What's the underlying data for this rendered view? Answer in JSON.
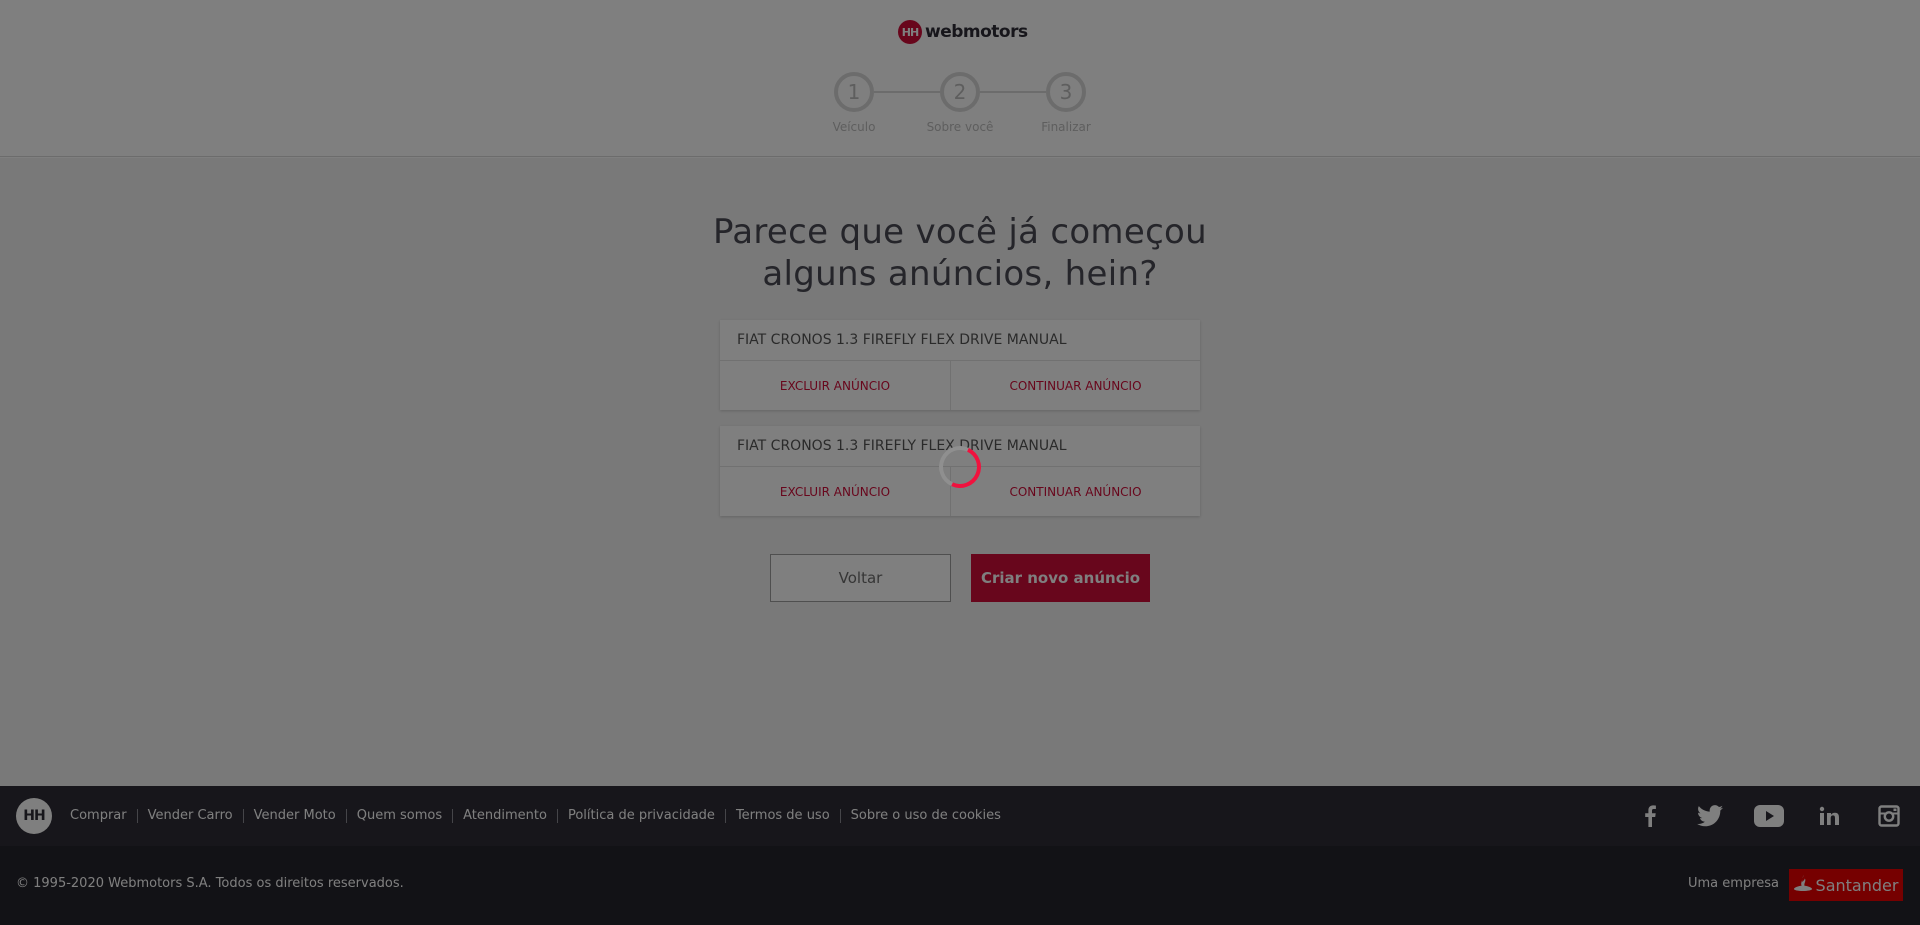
{
  "header": {
    "logo_mark": "HH",
    "logo_text": "webmotors",
    "steps": [
      {
        "number": "1",
        "label": "Veículo"
      },
      {
        "number": "2",
        "label": "Sobre você"
      },
      {
        "number": "3",
        "label": "Finalizar"
      }
    ]
  },
  "main": {
    "title_line1": "Parece que você já começou",
    "title_line2": "alguns anúncios, hein?",
    "drafts": [
      {
        "vehicle": "FIAT CRONOS 1.3 FIREFLY FLEX DRIVE MANUAL",
        "delete_label": "EXCLUIR ANÚNCIO",
        "continue_label": "CONTINUAR ANÚNCIO"
      },
      {
        "vehicle": "FIAT CRONOS 1.3 FIREFLY FLEX DRIVE MANUAL",
        "delete_label": "EXCLUIR ANÚNCIO",
        "continue_label": "CONTINUAR ANÚNCIO"
      }
    ],
    "back_label": "Voltar",
    "new_label": "Criar novo anúncio"
  },
  "footer": {
    "logo_mark": "HH",
    "links": [
      "Comprar",
      "Vender Carro",
      "Vender Moto",
      "Quem somos",
      "Atendimento",
      "Política de privacidade",
      "Termos de uso",
      "Sobre o uso de cookies"
    ],
    "social_icons": [
      "facebook-icon",
      "twitter-icon",
      "youtube-icon",
      "linkedin-icon",
      "instagram-icon"
    ],
    "copyright": "© 1995-2020 Webmotors S.A. Todos os direitos reservados.",
    "company_label": "Uma empresa",
    "company_brand": "Santander"
  },
  "colors": {
    "accent": "#d10d38",
    "footer_dark": "#2e2d37",
    "footer_darker": "#25242c",
    "santander_red": "#ec0000",
    "overlay": "rgba(0,0,0,0.5)"
  },
  "loading": true
}
